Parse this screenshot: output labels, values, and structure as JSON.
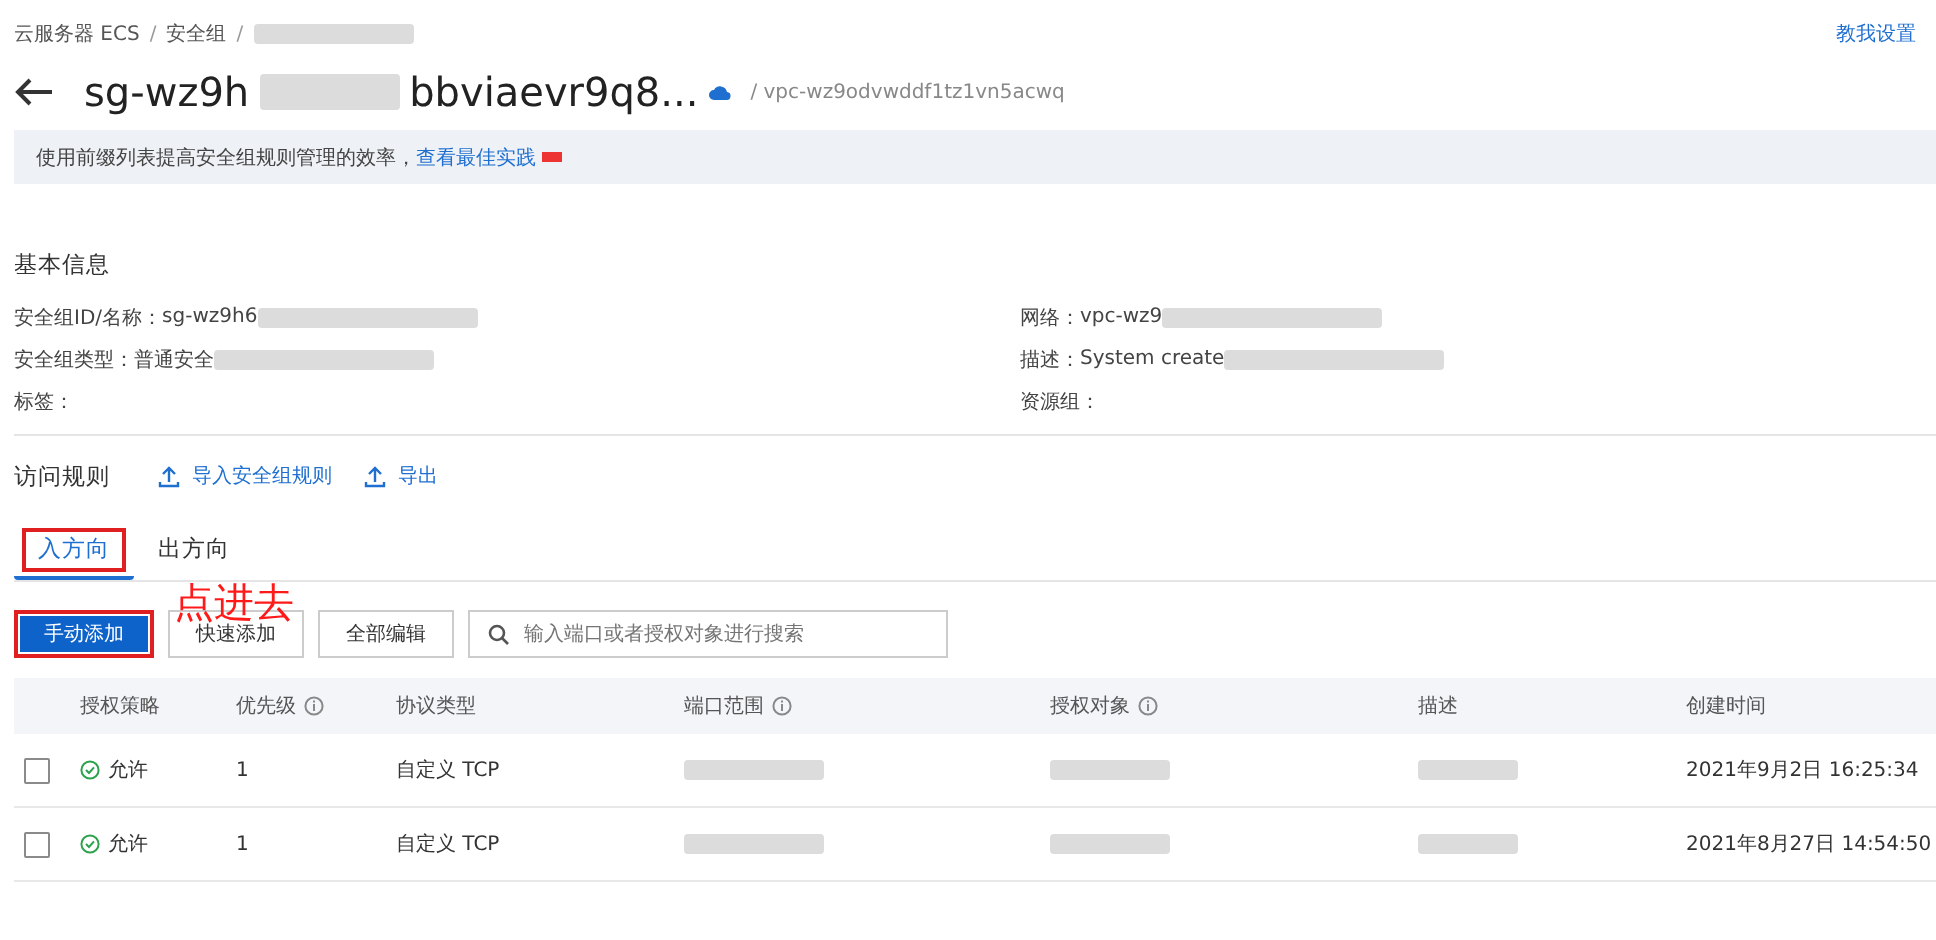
{
  "breadcrumb": [
    {
      "label": "云服务器 ECS",
      "separator": "/"
    },
    {
      "label": "安全组",
      "separator": "/"
    }
  ],
  "help_link": "教我设置",
  "title": {
    "start": "sg-wz9h",
    "end": "bbviaevr9q8...",
    "vpc": "/ vpc-wz9odvwddf1tz1vn5acwq"
  },
  "banner": {
    "text": "使用前缀列表提高安全组规则管理的效率，",
    "link": "查看最佳实践",
    "badge": true
  },
  "basic_info": {
    "heading": "基本信息",
    "fields": [
      {
        "label": "安全组ID/名称：",
        "value": "sg-wz9h6",
        "redacted": true
      },
      {
        "label": "网络：",
        "value": "vpc-wz9",
        "redacted": true
      },
      {
        "label": "安全组类型：",
        "value": "普通安全",
        "redacted": true
      },
      {
        "label": "描述：",
        "value": "System create",
        "redacted": true
      },
      {
        "label": "标签：",
        "redacted": false
      },
      {
        "label": "资源组：",
        "redacted": false
      }
    ]
  },
  "rules": {
    "heading": "访问规则",
    "actions": [
      "导入安全组规则",
      "导出"
    ]
  },
  "tabs": [
    {
      "label": "入方向",
      "selected": true,
      "annotated": true
    },
    {
      "label": "出方向",
      "selected": false,
      "annotated": false
    }
  ],
  "toolbar": {
    "buttons": [
      {
        "label": "手动添加",
        "primary": true,
        "annotated": true
      },
      {
        "label": "快速添加",
        "primary": false,
        "annotated": false
      },
      {
        "label": "全部编辑",
        "primary": false,
        "annotated": false
      }
    ],
    "search": {
      "placeholder": "输入端口或者授权对象进行搜索"
    }
  },
  "annotation": {
    "text": "点进去"
  },
  "table": {
    "columns": [
      {
        "label": "授权策略",
        "info": false
      },
      {
        "label": "优先级",
        "info": true
      },
      {
        "label": "协议类型",
        "info": false
      },
      {
        "label": "端口范围",
        "info": true
      },
      {
        "label": "授权对象",
        "info": true
      },
      {
        "label": "描述",
        "info": false
      },
      {
        "label": "创建时间",
        "info": false
      }
    ],
    "rows": [
      {
        "checked": false,
        "policy": "允许",
        "priority": "1",
        "protocol": "自定义 TCP",
        "created": "2021年9月2日 16:25:34"
      },
      {
        "checked": false,
        "policy": "允许",
        "priority": "1",
        "protocol": "自定义 TCP",
        "created": "2021年8月27日 14:54:50"
      }
    ]
  }
}
